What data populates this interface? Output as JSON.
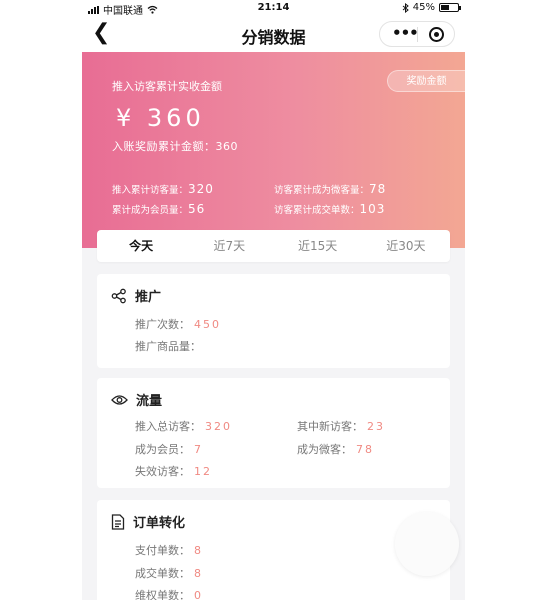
{
  "status_bar": {
    "carrier": "中国联通",
    "time": "21:14",
    "battery": "45%"
  },
  "nav": {
    "title": "分销数据"
  },
  "hero": {
    "label": "推入访客累计实收金额",
    "reward_button": "奖励金额",
    "amount": "¥ 360",
    "total": "入账奖励累计金额：360",
    "stats": {
      "visitors_label": "推入累计访客量：",
      "visitors_value": "320",
      "to_wechat_label": "访客累计成为微客量：",
      "to_wechat_value": "78",
      "members_label": "累计成为会员量：",
      "members_value": "56",
      "orders_label": "访客累计成交单数：",
      "orders_value": "103"
    }
  },
  "tabs": [
    "今天",
    "近7天",
    "近15天",
    "近30天"
  ],
  "promotion": {
    "title": "推广",
    "count_label": "推广次数：",
    "count_value": "450",
    "goods_label": "推广商品量：",
    "goods_value": ""
  },
  "traffic": {
    "title": "流量",
    "total_label": "推入总访客：",
    "total_value": "320",
    "new_label": "其中新访客：",
    "new_value": "23",
    "member_label": "成为会员：",
    "member_value": "7",
    "wechat_label": "成为微客：",
    "wechat_value": "78",
    "lost_label": "失效访客：",
    "lost_value": "12"
  },
  "orders": {
    "title": "订单转化",
    "paid_label": "支付单数：",
    "paid_value": "8",
    "deal_label": "成交单数：",
    "deal_value": "8",
    "rights_label": "维权单数：",
    "rights_value": "0"
  },
  "colors": {
    "accent": "#f08a83",
    "hero_start": "#e86d94",
    "hero_end": "#f3a793"
  },
  "icons": [
    "signal-icon",
    "wifi-icon",
    "bluetooth-icon",
    "battery-icon",
    "back-icon",
    "more-icon",
    "target-icon",
    "share-icon",
    "eye-icon",
    "document-icon"
  ]
}
